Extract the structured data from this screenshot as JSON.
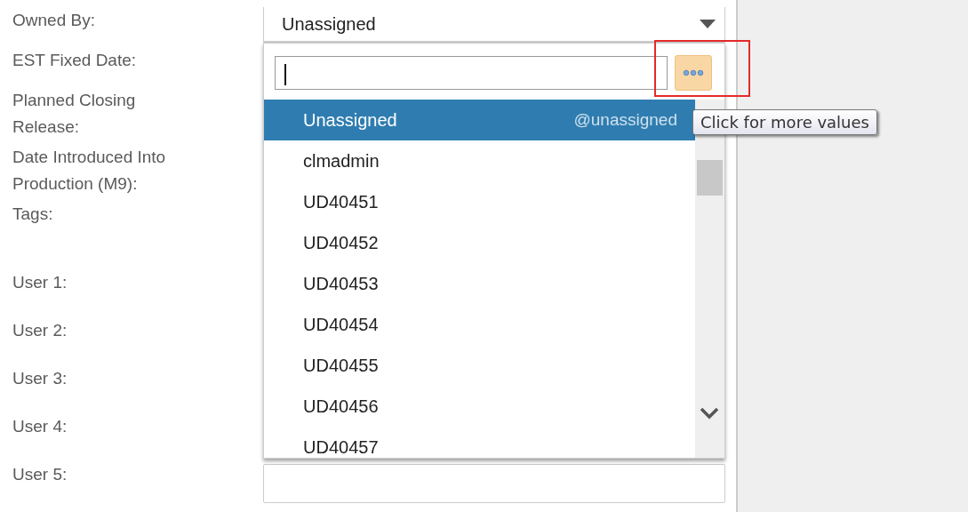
{
  "labels": [
    {
      "text": "Owned By:",
      "kind": "single"
    },
    {
      "text": "EST Fixed Date:",
      "kind": "single"
    },
    {
      "text": "Planned Closing Release:",
      "kind": "double"
    },
    {
      "text": "Date Introduced Into Production (M9):",
      "kind": "double"
    },
    {
      "text": "Tags:",
      "kind": "tall"
    },
    {
      "text": "User 1:",
      "kind": "user"
    },
    {
      "text": "User 2:",
      "kind": "user"
    },
    {
      "text": "User 3:",
      "kind": "user"
    },
    {
      "text": "User 4:",
      "kind": "user"
    },
    {
      "text": "User 5:",
      "kind": "user"
    }
  ],
  "owned_by": {
    "value": "Unassigned",
    "expanded": true
  },
  "popup": {
    "search": {
      "focused": true
    },
    "more_button": {
      "highlighted": true,
      "tooltip": "Click for more values"
    },
    "options": [
      {
        "label": "Unassigned",
        "hint": "@unassigned",
        "selected": true
      },
      {
        "label": "clmadmin",
        "selected": false
      },
      {
        "label": "UD40451",
        "selected": false
      },
      {
        "label": "UD40452",
        "selected": false
      },
      {
        "label": "UD40453",
        "selected": false
      },
      {
        "label": "UD40454",
        "selected": false
      },
      {
        "label": "UD40455",
        "selected": false
      },
      {
        "label": "UD40456",
        "selected": false
      },
      {
        "label": "UD40457",
        "selected": false
      }
    ]
  }
}
